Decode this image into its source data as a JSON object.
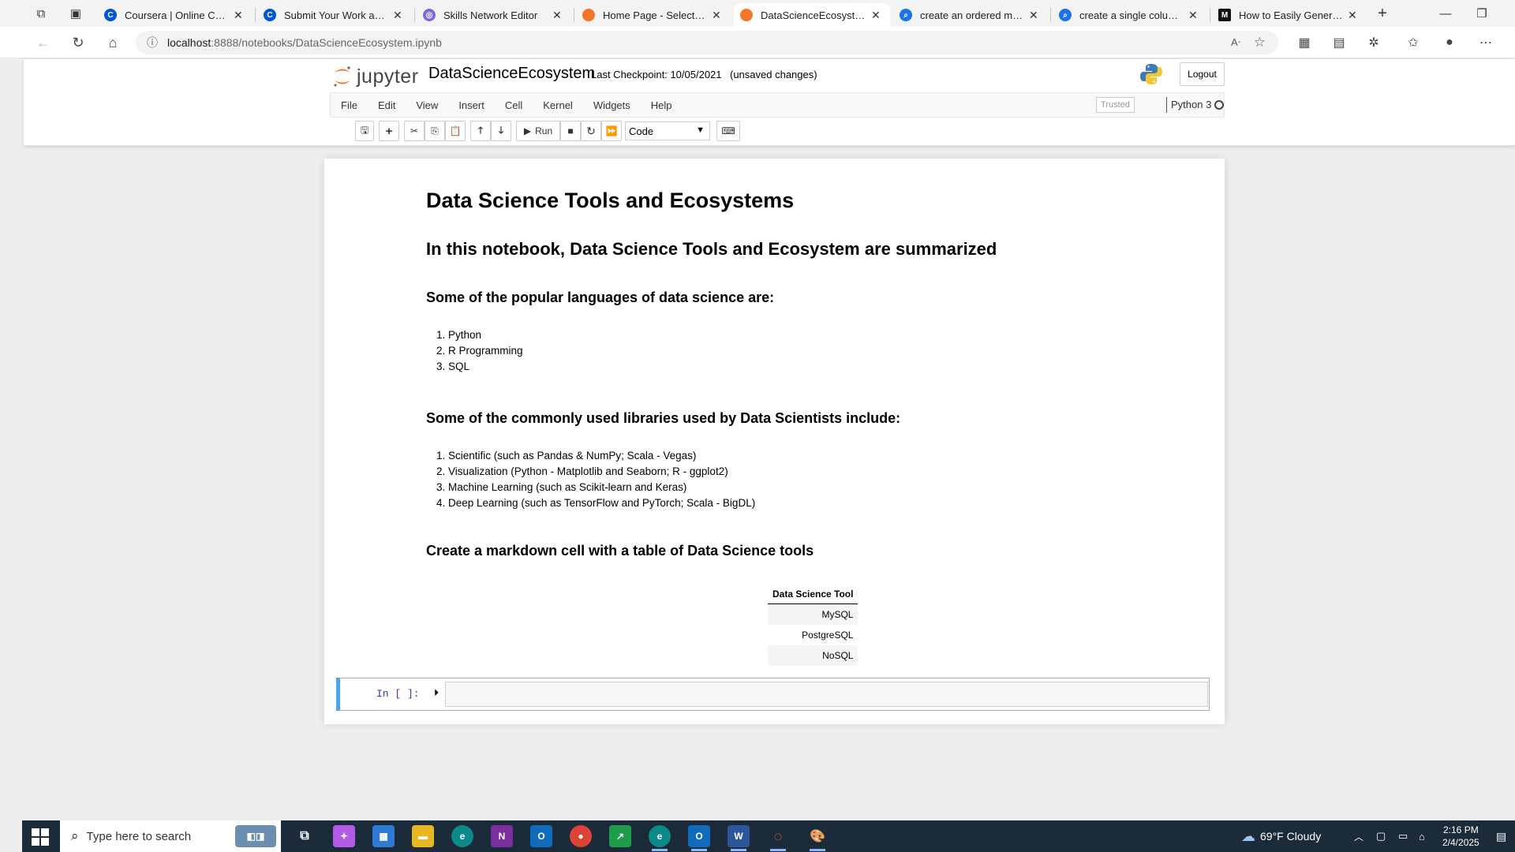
{
  "browser": {
    "tabs": [
      {
        "label": "Coursera | Online Courses",
        "favicon_color": "#0056d2"
      },
      {
        "label": "Submit Your Work and Gra",
        "favicon_color": "#0056d2"
      },
      {
        "label": "Skills Network Editor",
        "favicon_color": "#7c6bd6"
      },
      {
        "label": "Home Page - Select or cre",
        "favicon_color": "#f37626"
      },
      {
        "label": "DataScienceEcosystem - Ju",
        "favicon_color": "#f37626",
        "active": true
      },
      {
        "label": "create an ordered markdo",
        "favicon_color": "#1a73e8"
      },
      {
        "label": "create a single column ma",
        "favicon_color": "#1a73e8"
      },
      {
        "label": "How to Easily Generate a T",
        "favicon_color": "#111111"
      }
    ],
    "url_host": "localhost",
    "url_path": ":8888/notebooks/DataScienceEcosystem.ipynb",
    "new_tab_label": "+"
  },
  "jupyter": {
    "logo_text": "jupyter",
    "notebook_name": "DataScienceEcosystem",
    "checkpoint": "Last Checkpoint: 10/05/2021",
    "unsaved": "(unsaved changes)",
    "logout": "Logout",
    "menu": [
      "File",
      "Edit",
      "View",
      "Insert",
      "Cell",
      "Kernel",
      "Widgets",
      "Help"
    ],
    "trusted": "Trusted",
    "kernel": "Python 3",
    "run_label": "Run",
    "cell_type": "Code"
  },
  "notebook": {
    "title": "Data Science Tools and Ecosystems",
    "intro": "In this notebook, Data Science Tools and Ecosystem are summarized",
    "languages_heading": "Some of the popular languages of data science are:",
    "languages": [
      "Python",
      "R Programming",
      "SQL"
    ],
    "libraries_heading": "Some of the commonly used libraries used by Data Scientists include:",
    "libraries": [
      "Scientific (such as Pandas & NumPy; Scala - Vegas)",
      "Visualization (Python - Matplotlib and Seaborn; R - ggplot2)",
      "Machine Learning (such as Scikit-learn and Keras)",
      "Deep Learning (such as TensorFlow and PyTorch; Scala - BigDL)"
    ],
    "table_heading": "Create a markdown cell with a table of Data Science tools",
    "table_header": "Data Science Tool",
    "table_rows": [
      "MySQL",
      "PostgreSQL",
      "NoSQL"
    ],
    "prompt": "In [ ]:"
  },
  "taskbar": {
    "search_placeholder": "Type here to search",
    "weather": "69°F  Cloudy",
    "time": "2:16 PM",
    "date": "2/4/2025"
  }
}
